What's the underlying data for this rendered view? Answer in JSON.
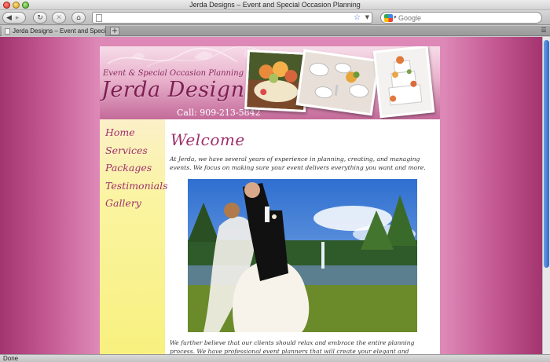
{
  "browser": {
    "window_title": "Jerda Designs – Event and Special Occasion Planning",
    "url_value": "",
    "search_placeholder": "Google",
    "tab_title": "Jerda Designs – Event and Special Occasion Planning",
    "new_tab_label": "+",
    "status_text": "Done"
  },
  "site": {
    "tagline": "Event & Special Occasion Planning",
    "logo_text": "Jerda Designs",
    "phone": "Call: 909-213-5842",
    "nav": [
      "Home",
      "Services",
      "Packages",
      "Testimonials",
      "Gallery"
    ],
    "welcome_heading": "Welcome",
    "intro_text": "At Jerda, we have several years of experience in planning, creating, and managing events. We focus on making sure your event delivers everything you want and more.",
    "body_text": "We further believe that our clients should relax and embrace the entire planning process. We have professional event planners that will create your elegant and irreplaceable event. Our company is ready to"
  },
  "colors": {
    "brand_plum": "#7d1f52",
    "nav_link": "#a02e6c",
    "sidebar_yellow": "#f8f07a",
    "background_magenta": "#c55a93"
  },
  "icons": [
    "back-arrow-icon",
    "forward-arrow-icon",
    "reload-icon",
    "stop-icon",
    "home-icon",
    "page-icon",
    "bookmark-star-icon",
    "google-icon",
    "new-tab-icon",
    "tab-menu-icon"
  ]
}
